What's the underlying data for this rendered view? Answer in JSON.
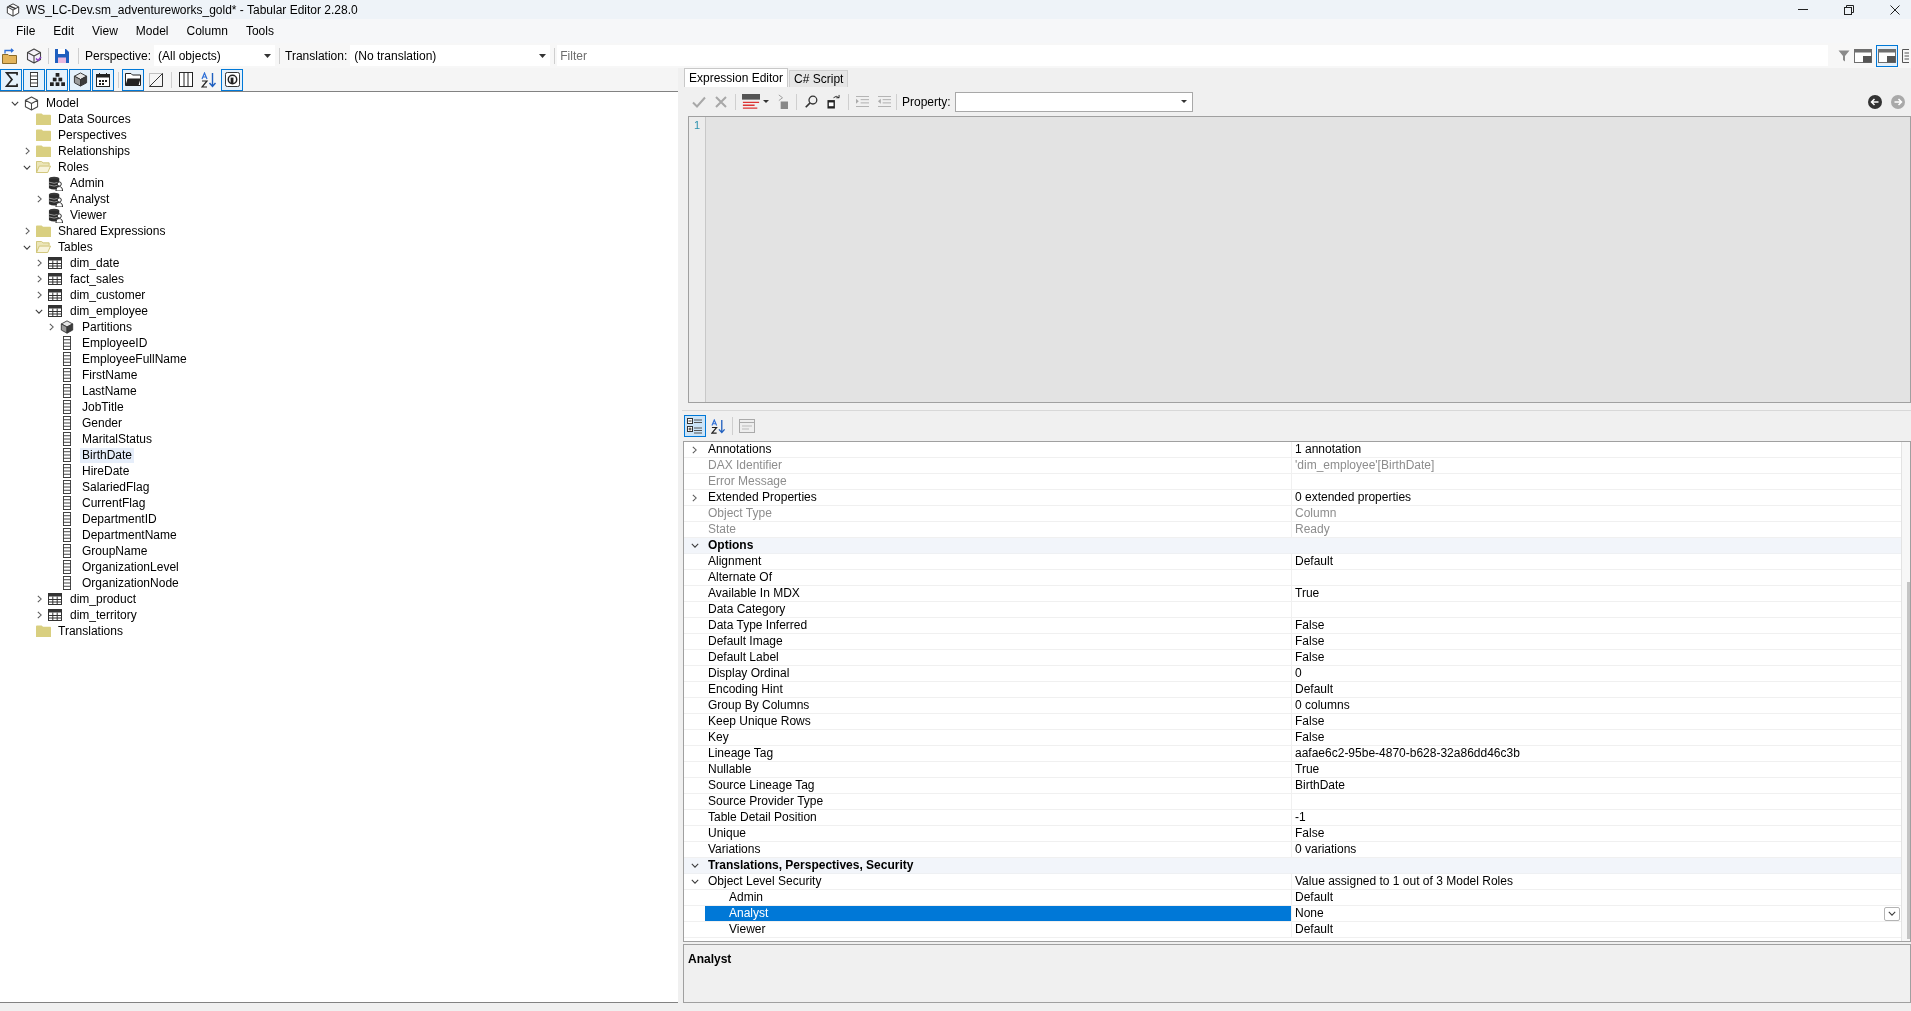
{
  "window": {
    "title": "WS_LC-Dev.sm_adventureworks_gold* - Tabular Editor 2.28.0"
  },
  "menu": [
    "File",
    "Edit",
    "View",
    "Model",
    "Column",
    "Tools"
  ],
  "toolbar": {
    "perspective_label": "Perspective:",
    "perspective_value": "(All objects)",
    "translation_label": "Translation:",
    "translation_value": "(No translation)",
    "filter": {
      "placeholder": "Filter"
    },
    "view_buttons": [
      {
        "on": false
      },
      {
        "on": true
      },
      {
        "on": false
      }
    ]
  },
  "tree_toolbar": [
    {
      "on": true
    },
    {
      "on": true
    },
    {
      "on": true
    },
    {
      "on": true
    },
    {
      "on": true
    },
    {
      "on": true
    },
    {
      "on": false
    },
    {
      "on": false
    },
    {
      "on": false
    },
    {
      "on": true
    }
  ],
  "tree": {
    "items": [
      {
        "label": "Model",
        "kind": "model",
        "expanded": true,
        "selected": false,
        "children": [
          {
            "label": "Data Sources",
            "kind": "folder",
            "selected": false
          },
          {
            "label": "Perspectives",
            "kind": "folder",
            "selected": false
          },
          {
            "label": "Relationships",
            "kind": "folder",
            "expanded": false,
            "selected": false
          },
          {
            "label": "Roles",
            "kind": "folder",
            "expanded": true,
            "selected": false,
            "children": [
              {
                "label": "Admin",
                "kind": "role",
                "selected": false
              },
              {
                "label": "Analyst",
                "kind": "role",
                "expanded": false,
                "selected": false
              },
              {
                "label": "Viewer",
                "kind": "role",
                "selected": false
              }
            ]
          },
          {
            "label": "Shared Expressions",
            "kind": "folder",
            "expanded": false,
            "selected": false
          },
          {
            "label": "Tables",
            "kind": "folder",
            "expanded": true,
            "selected": false,
            "children": [
              {
                "label": "dim_date",
                "kind": "table",
                "expanded": false,
                "selected": false
              },
              {
                "label": "fact_sales",
                "kind": "table",
                "expanded": false,
                "selected": false
              },
              {
                "label": "dim_customer",
                "kind": "table",
                "expanded": false,
                "selected": false
              },
              {
                "label": "dim_employee",
                "kind": "table",
                "expanded": true,
                "selected": false,
                "children": [
                  {
                    "label": "Partitions",
                    "kind": "partitions",
                    "expanded": false,
                    "selected": false
                  },
                  {
                    "label": "EmployeeID",
                    "kind": "column",
                    "selected": false
                  },
                  {
                    "label": "EmployeeFullName",
                    "kind": "column",
                    "selected": false
                  },
                  {
                    "label": "FirstName",
                    "kind": "column",
                    "selected": false
                  },
                  {
                    "label": "LastName",
                    "kind": "column",
                    "selected": false
                  },
                  {
                    "label": "JobTitle",
                    "kind": "column",
                    "selected": false
                  },
                  {
                    "label": "Gender",
                    "kind": "column",
                    "selected": false
                  },
                  {
                    "label": "MaritalStatus",
                    "kind": "column",
                    "selected": false
                  },
                  {
                    "label": "BirthDate",
                    "kind": "column",
                    "selected": true
                  },
                  {
                    "label": "HireDate",
                    "kind": "column",
                    "selected": false
                  },
                  {
                    "label": "SalariedFlag",
                    "kind": "column",
                    "selected": false
                  },
                  {
                    "label": "CurrentFlag",
                    "kind": "column",
                    "selected": false
                  },
                  {
                    "label": "DepartmentID",
                    "kind": "column",
                    "selected": false
                  },
                  {
                    "label": "DepartmentName",
                    "kind": "column",
                    "selected": false
                  },
                  {
                    "label": "GroupName",
                    "kind": "column",
                    "selected": false
                  },
                  {
                    "label": "OrganizationLevel",
                    "kind": "column",
                    "selected": false
                  },
                  {
                    "label": "OrganizationNode",
                    "kind": "column",
                    "selected": false
                  }
                ]
              },
              {
                "label": "dim_product",
                "kind": "table",
                "expanded": false,
                "selected": false
              },
              {
                "label": "dim_territory",
                "kind": "table",
                "expanded": false,
                "selected": false
              }
            ]
          },
          {
            "label": "Translations",
            "kind": "folder",
            "selected": false
          }
        ]
      }
    ]
  },
  "editor": {
    "tabs": [
      {
        "label": "Expression Editor",
        "selected": true
      },
      {
        "label": "C# Script",
        "selected": false
      }
    ],
    "property_label": "Property:",
    "line_numbers": [
      "1"
    ]
  },
  "grid": {
    "sort_buttons": [
      {
        "on": true
      },
      {
        "on": false
      }
    ],
    "rows": [
      {
        "kind": "property",
        "name": "Annotations",
        "value": "1 annotation",
        "readonly": false,
        "expanded": false,
        "selected": false
      },
      {
        "kind": "property",
        "name": "DAX Identifier",
        "value": "'dim_employee'[BirthDate]",
        "readonly": true,
        "selected": false
      },
      {
        "kind": "property",
        "name": "Error Message",
        "readonly": true,
        "selected": false
      },
      {
        "kind": "property",
        "name": "Extended Properties",
        "value": "0 extended properties",
        "readonly": false,
        "expanded": false,
        "selected": false
      },
      {
        "kind": "property",
        "name": "Object Type",
        "value": "Column",
        "readonly": true,
        "selected": false
      },
      {
        "kind": "property",
        "name": "State",
        "value": "Ready",
        "readonly": true,
        "selected": false
      },
      {
        "kind": "category",
        "name": "Options",
        "expanded": true,
        "selected": false,
        "children": [
          {
            "kind": "property",
            "name": "Alignment",
            "value": "Default",
            "readonly": false,
            "selected": false
          },
          {
            "kind": "property",
            "name": "Alternate Of",
            "readonly": false,
            "selected": false
          },
          {
            "kind": "property",
            "name": "Available In MDX",
            "value": "True",
            "readonly": false,
            "selected": false
          },
          {
            "kind": "property",
            "name": "Data Category",
            "readonly": false,
            "selected": false
          },
          {
            "kind": "property",
            "name": "Data Type Inferred",
            "value": "False",
            "readonly": false,
            "selected": false
          },
          {
            "kind": "property",
            "name": "Default Image",
            "value": "False",
            "readonly": false,
            "selected": false
          },
          {
            "kind": "property",
            "name": "Default Label",
            "value": "False",
            "readonly": false,
            "selected": false
          },
          {
            "kind": "property",
            "name": "Display Ordinal",
            "value": "0",
            "readonly": false,
            "selected": false
          },
          {
            "kind": "property",
            "name": "Encoding Hint",
            "value": "Default",
            "readonly": false,
            "selected": false
          },
          {
            "kind": "property",
            "name": "Group By Columns",
            "value": "0 columns",
            "readonly": false,
            "selected": false
          },
          {
            "kind": "property",
            "name": "Keep Unique Rows",
            "value": "False",
            "readonly": false,
            "selected": false
          },
          {
            "kind": "property",
            "name": "Key",
            "value": "False",
            "readonly": false,
            "selected": false
          },
          {
            "kind": "property",
            "name": "Lineage Tag",
            "value": "aafae6c2-95be-4870-b628-32a86dd46c3b",
            "readonly": false,
            "selected": false
          },
          {
            "kind": "property",
            "name": "Nullable",
            "value": "True",
            "readonly": false,
            "selected": false
          },
          {
            "kind": "property",
            "name": "Source Lineage Tag",
            "value": "BirthDate",
            "readonly": false,
            "selected": false
          },
          {
            "kind": "property",
            "name": "Source Provider Type",
            "readonly": false,
            "selected": false
          },
          {
            "kind": "property",
            "name": "Table Detail Position",
            "value": "-1",
            "readonly": false,
            "selected": false
          },
          {
            "kind": "property",
            "name": "Unique",
            "value": "False",
            "readonly": false,
            "selected": false
          },
          {
            "kind": "property",
            "name": "Variations",
            "value": "0 variations",
            "readonly": false,
            "selected": false
          }
        ]
      },
      {
        "kind": "category",
        "name": "Translations, Perspectives, Security",
        "expanded": true,
        "selected": false,
        "children": [
          {
            "kind": "property",
            "name": "Object Level Security",
            "value": "Value assigned to 1 out of 3 Model Roles",
            "readonly": false,
            "expanded": true,
            "selected": false,
            "children": [
              {
                "kind": "property",
                "name": "Admin",
                "value": "Default",
                "readonly": false,
                "selected": false
              },
              {
                "kind": "property",
                "name": "Analyst",
                "value": "None",
                "readonly": false,
                "selected": true
              },
              {
                "kind": "property",
                "name": "Viewer",
                "value": "Default",
                "readonly": false,
                "selected": false
              }
            ]
          }
        ]
      }
    ]
  },
  "description": {
    "title": "Analyst"
  }
}
